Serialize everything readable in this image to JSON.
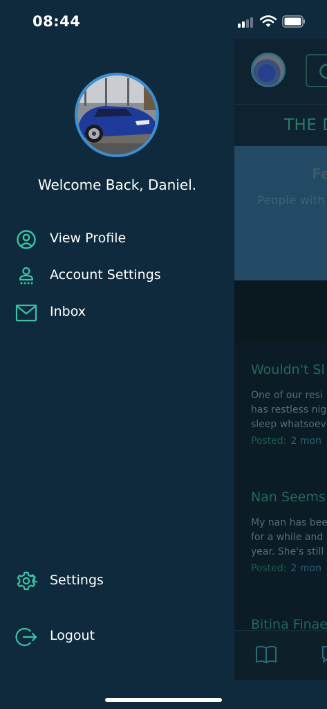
{
  "status_bar": {
    "time": "08:44"
  },
  "drawer": {
    "welcome_text": "Welcome Back, Daniel.",
    "menu": [
      {
        "label": "View Profile",
        "icon": "user-circle-icon"
      },
      {
        "label": "Account Settings",
        "icon": "account-settings-icon"
      },
      {
        "label": "Inbox",
        "icon": "mail-icon"
      }
    ],
    "bottom_menu": [
      {
        "label": "Settings",
        "icon": "gear-icon"
      },
      {
        "label": "Logout",
        "icon": "logout-icon"
      }
    ]
  },
  "background_app": {
    "title": "THE D",
    "feature_title": "Fe",
    "feature_text": "People with the",
    "posts": [
      {
        "title": "Wouldn't Sl",
        "lines": [
          "One of our resi",
          "has restless nig",
          "sleep whatsoev"
        ],
        "posted_label": "Posted:",
        "when": "2 mon"
      },
      {
        "title": "Nan Seems",
        "lines": [
          "My nan has bee",
          "for a while and",
          "year. She's still"
        ],
        "posted_label": "Posted:",
        "when": "2 mon"
      },
      {
        "title": "Bitina Finae",
        "lines": [],
        "posted_label": "",
        "when": ""
      }
    ]
  },
  "colors": {
    "drawer_bg": "#0f2a3d",
    "accent_teal": "#3cc3a6",
    "avatar_border": "#3d8fd0"
  }
}
